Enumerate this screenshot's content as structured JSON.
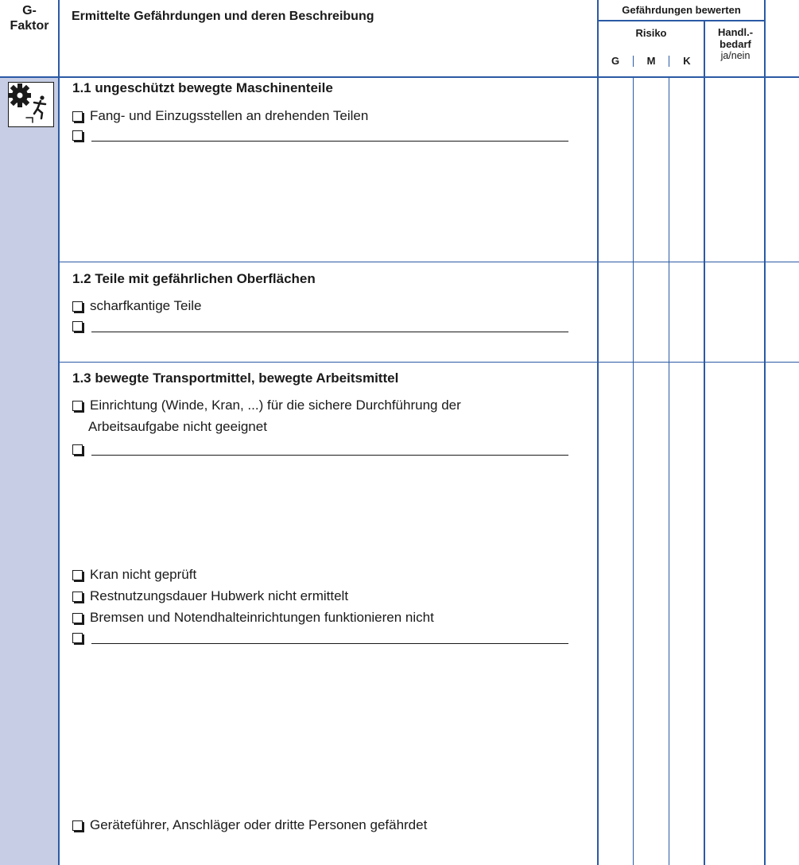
{
  "header": {
    "g_faktor": [
      "G-",
      "Faktor"
    ],
    "description": "Ermittelte Gefährdungen und deren Beschreibung",
    "bewerten": "Gefährdungen bewerten",
    "risiko": "Risiko",
    "risk_levels": [
      "G",
      "M",
      "K"
    ],
    "handl": [
      "Handl.-",
      "bedarf"
    ],
    "ja_nein": "ja/nein"
  },
  "sections": [
    {
      "title": "1.1  ungeschützt bewegte Maschinenteile",
      "items": [
        "Fang- und Einzugsstellen an drehenden Teilen"
      ]
    },
    {
      "title": "1.2  Teile mit gefährlichen Oberflächen",
      "items": [
        "scharfkantige Teile"
      ]
    },
    {
      "title": "1.3  bewegte Transportmittel, bewegte Arbeitsmittel",
      "items": [
        "Einrichtung (Winde, Kran, ...) für die sichere Durchführung der",
        "Arbeitsaufgabe nicht geeignet",
        "Kran nicht geprüft",
        "Restnutzungsdauer Hubwerk nicht ermittelt",
        "Bremsen und Notendhalteinrichtungen funktionieren nicht",
        "Geräteführer, Anschläger oder dritte Personen gefährdet"
      ]
    }
  ],
  "icon": "gear-person-hazard-icon",
  "colors": {
    "rule": "#2b5aa5",
    "g_column": "#c6cde4"
  }
}
